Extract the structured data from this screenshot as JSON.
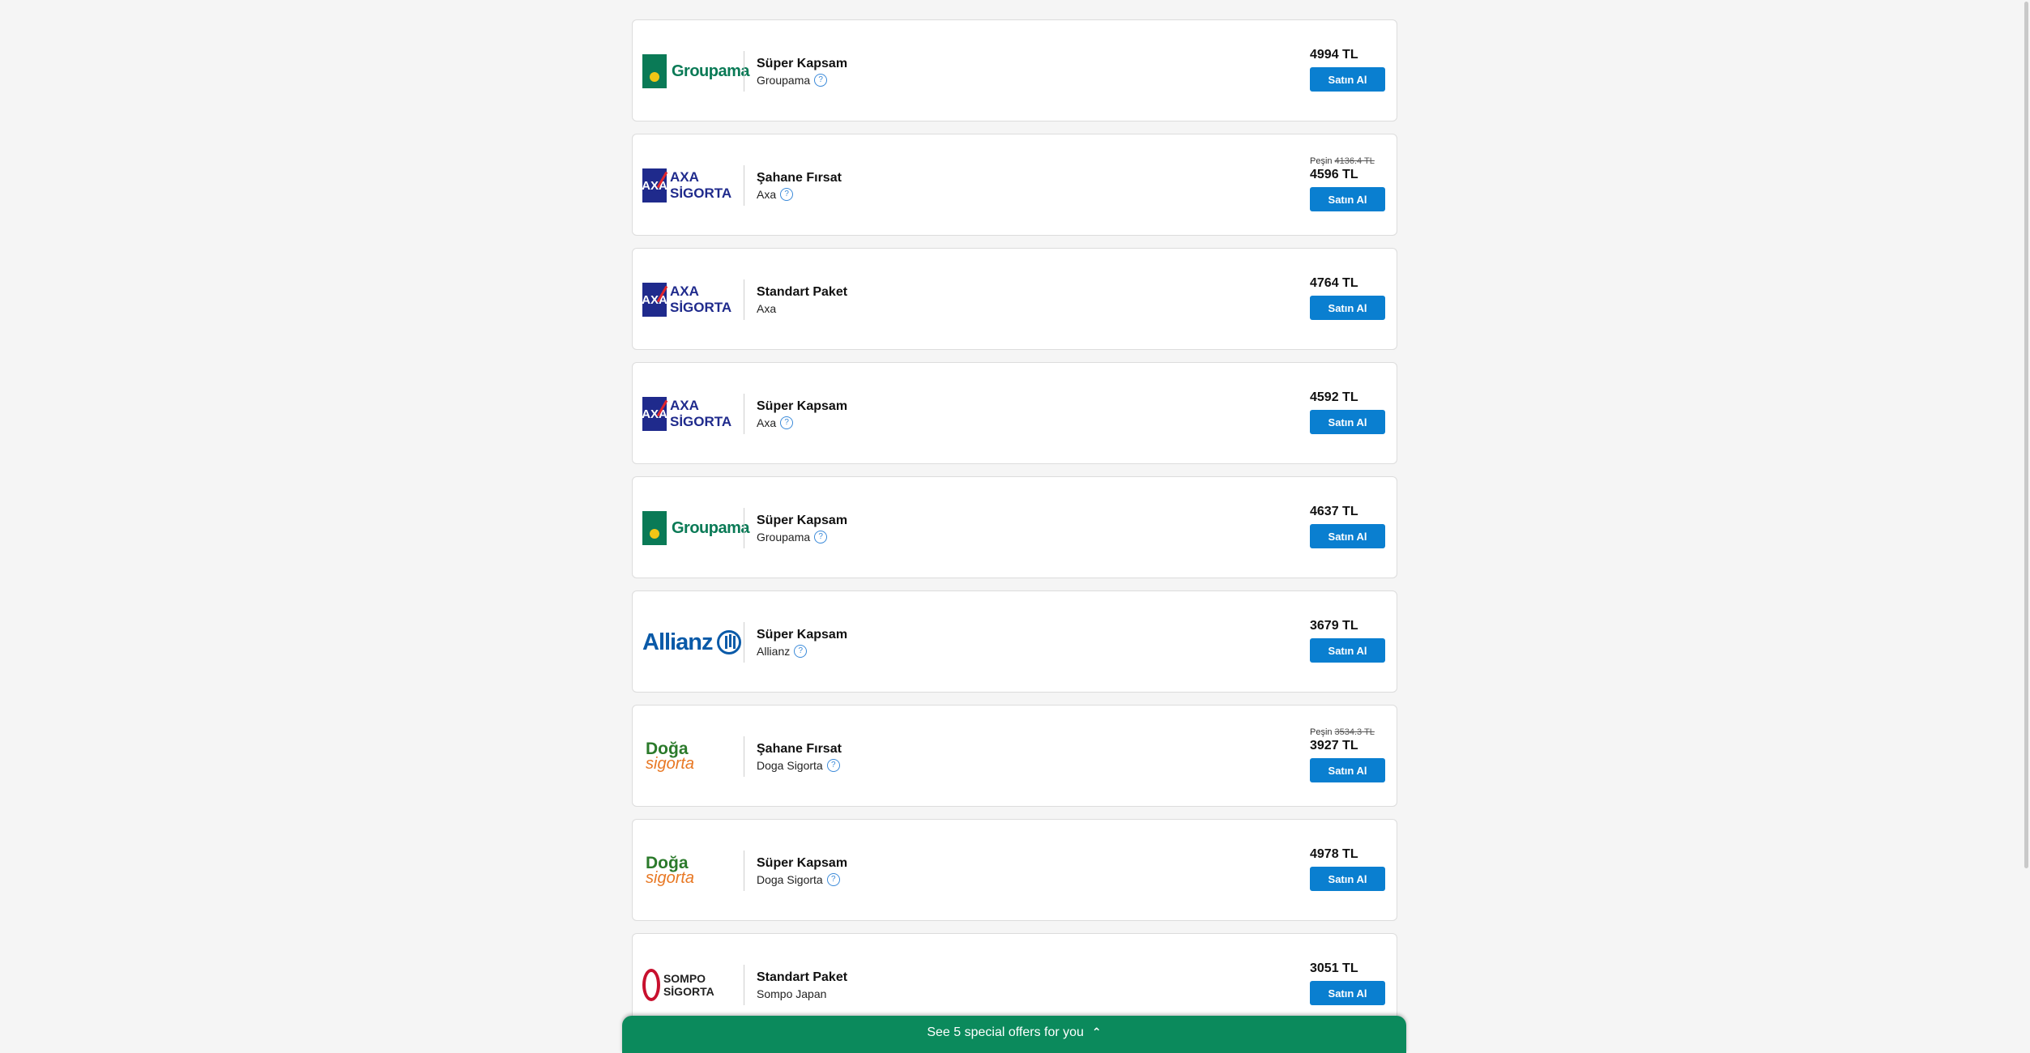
{
  "offers": [
    {
      "logo": "groupama",
      "logo_text": "Groupama",
      "product": "Süper Kapsam",
      "company": "Groupama",
      "help": true,
      "cash_label": "",
      "cash_price": "",
      "price": "4994 TL",
      "button": "Satın Al"
    },
    {
      "logo": "axa",
      "logo_text": "AXA SİGORTA",
      "product": "Şahane Fırsat",
      "company": "Axa",
      "help": true,
      "cash_label": "Peşin",
      "cash_price": "4136.4 TL",
      "price": "4596 TL",
      "button": "Satın Al"
    },
    {
      "logo": "axa",
      "logo_text": "AXA SİGORTA",
      "product": "Standart Paket",
      "company": "Axa",
      "help": false,
      "cash_label": "",
      "cash_price": "",
      "price": "4764 TL",
      "button": "Satın Al"
    },
    {
      "logo": "axa",
      "logo_text": "AXA SİGORTA",
      "product": "Süper Kapsam",
      "company": "Axa",
      "help": true,
      "cash_label": "",
      "cash_price": "",
      "price": "4592 TL",
      "button": "Satın Al"
    },
    {
      "logo": "groupama",
      "logo_text": "Groupama",
      "product": "Süper Kapsam",
      "company": "Groupama",
      "help": true,
      "cash_label": "",
      "cash_price": "",
      "price": "4637 TL",
      "button": "Satın Al"
    },
    {
      "logo": "allianz",
      "logo_text": "Allianz",
      "product": "Süper Kapsam",
      "company": "Allianz",
      "help": true,
      "cash_label": "",
      "cash_price": "",
      "price": "3679 TL",
      "button": "Satın Al"
    },
    {
      "logo": "doga",
      "logo_text": "Doğa sigorta",
      "product": "Şahane Fırsat",
      "company": "Doga Sigorta",
      "help": true,
      "cash_label": "Peşin",
      "cash_price": "3534.3 TL",
      "price": "3927 TL",
      "button": "Satın Al"
    },
    {
      "logo": "doga",
      "logo_text": "Doğa sigorta",
      "product": "Süper Kapsam",
      "company": "Doga Sigorta",
      "help": true,
      "cash_label": "",
      "cash_price": "",
      "price": "4978 TL",
      "button": "Satın Al"
    },
    {
      "logo": "sompo",
      "logo_text": "SOMPO SİGORTA",
      "product": "Standart Paket",
      "company": "Sompo Japan",
      "help": false,
      "cash_label": "",
      "cash_price": "",
      "price": "3051 TL",
      "button": "Satın Al"
    }
  ],
  "banner": {
    "label": "See 5 special offers for you",
    "icon": "double-chevron-up-icon"
  },
  "colors": {
    "accent": "#0a7fd0",
    "banner": "#0b8a5c"
  }
}
